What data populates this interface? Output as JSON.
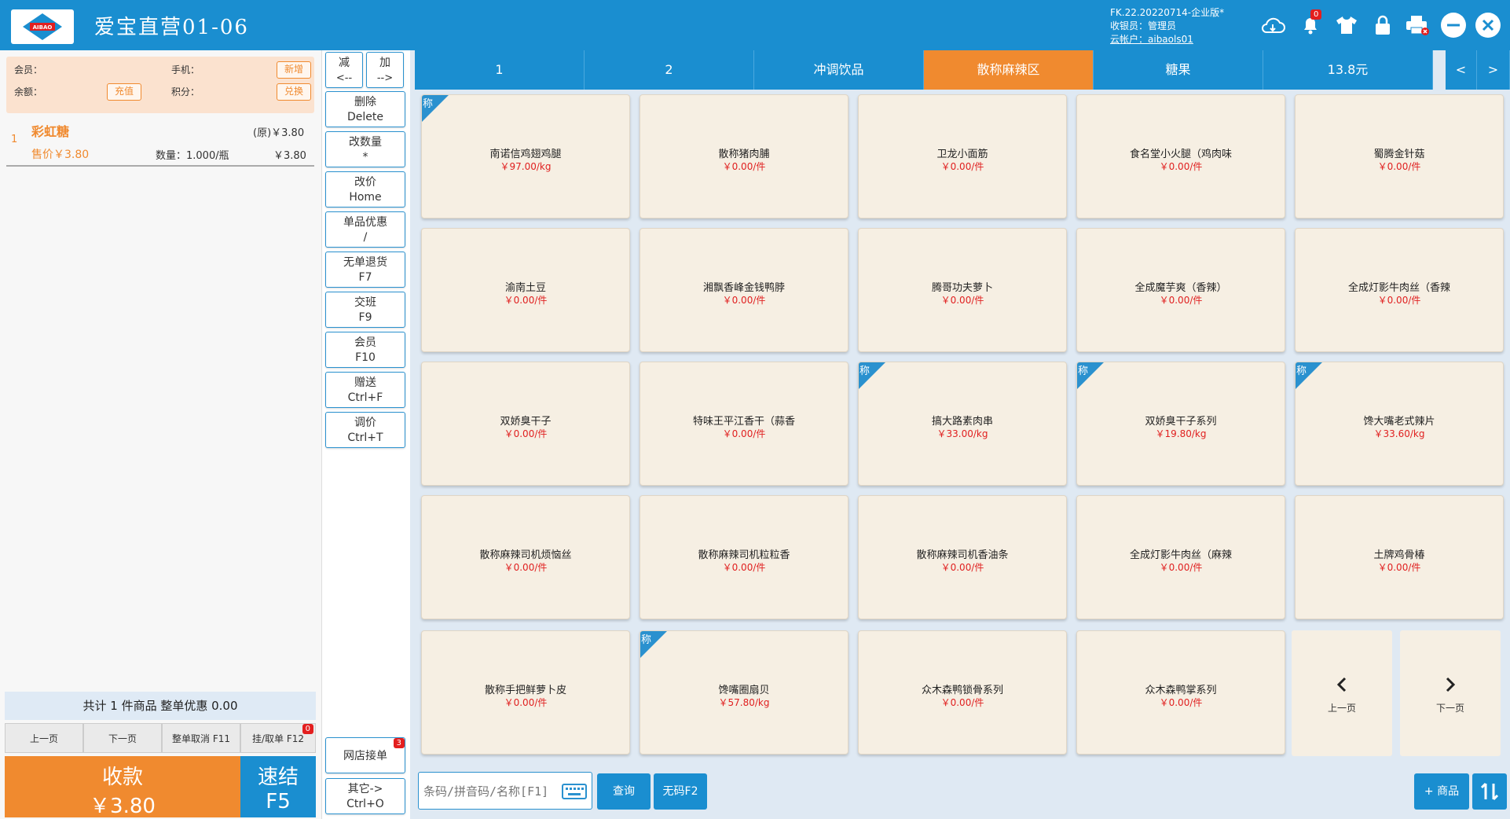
{
  "header": {
    "logo_text": "AIBAO",
    "logo_sub": "爱宝",
    "store_title": "爱宝直营01-06",
    "version": "FK.22.20220714-企业版*",
    "cashier": "收银员：管理员",
    "cloud_account": "云帐户：aibaols01",
    "notify_count": "0"
  },
  "member": {
    "member_label": "会员：",
    "phone_label": "手机：",
    "balance_label": "余额：",
    "points_label": "积分：",
    "new_btn": "新增",
    "recharge_btn": "充值",
    "redeem_btn": "兑换"
  },
  "cart": {
    "items": [
      {
        "index": "1",
        "name": "彩虹糖",
        "orig_price": "(原)￥3.80",
        "sale_price": "售价￥3.80",
        "qty": "数量：1.000/瓶",
        "subtotal": "￥3.80"
      }
    ],
    "summary": "共计 1 件商品 整单优惠 0.00",
    "prev_page": "上一页",
    "next_page": "下一页",
    "cancel_all": "整单取消 F11",
    "hold_order": "挂/取单 F12",
    "hold_count": "0",
    "pay_label": "收款",
    "pay_amount": "￥3.80",
    "quick_label": "速结",
    "quick_key": "F5"
  },
  "functions": {
    "minus": "减",
    "minus_key": "<--",
    "plus": "加",
    "plus_key": "-->",
    "buttons": [
      {
        "label": "删除",
        "key": "Delete"
      },
      {
        "label": "改数量",
        "key": "*"
      },
      {
        "label": "改价",
        "key": "Home"
      },
      {
        "label": "单品优惠",
        "key": "/"
      },
      {
        "label": "无单退货",
        "key": "F7"
      },
      {
        "label": "交班",
        "key": "F9"
      },
      {
        "label": "会员",
        "key": "F10"
      },
      {
        "label": "赠送",
        "key": "Ctrl+F"
      },
      {
        "label": "调价",
        "key": "Ctrl+T"
      }
    ],
    "online_order": "网店接单",
    "online_count": "3",
    "other": "其它->",
    "other_key": "Ctrl+O"
  },
  "tabs": [
    {
      "label": "1"
    },
    {
      "label": "2"
    },
    {
      "label": "冲调饮品"
    },
    {
      "label": "散称麻辣区"
    },
    {
      "label": "糖果"
    },
    {
      "label": "13.8元"
    }
  ],
  "tab_prev": "<",
  "tab_next": ">",
  "weigh_tag": "称",
  "products": [
    {
      "name": "南诺信鸡翅鸡腿",
      "price": "￥97.00/kg",
      "weighed": true
    },
    {
      "name": "散称猪肉脯",
      "price": "￥0.00/件",
      "weighed": false
    },
    {
      "name": "卫龙小面筋",
      "price": "￥0.00/件",
      "weighed": false
    },
    {
      "name": "食名堂小火腿（鸡肉味",
      "price": "￥0.00/件",
      "weighed": false
    },
    {
      "name": "蜀腾金针菇",
      "price": "￥0.00/件",
      "weighed": false
    },
    {
      "name": "渝南土豆",
      "price": "￥0.00/件",
      "weighed": false
    },
    {
      "name": "湘飘香峰金钱鸭脖",
      "price": "￥0.00/件",
      "weighed": false
    },
    {
      "name": "腾哥功夫萝卜",
      "price": "￥0.00/件",
      "weighed": false
    },
    {
      "name": "全成魔芋爽（香辣）",
      "price": "￥0.00/件",
      "weighed": false
    },
    {
      "name": "全成灯影牛肉丝（香辣",
      "price": "￥0.00/件",
      "weighed": false
    },
    {
      "name": "双娇臭干子",
      "price": "￥0.00/件",
      "weighed": false
    },
    {
      "name": "特味王平江香干（蒜香",
      "price": "￥0.00/件",
      "weighed": false
    },
    {
      "name": "搞大路素肉串",
      "price": "￥33.00/kg",
      "weighed": true
    },
    {
      "name": "双娇臭干子系列",
      "price": "￥19.80/kg",
      "weighed": true
    },
    {
      "name": "馋大嘴老式辣片",
      "price": "￥33.60/kg",
      "weighed": true
    },
    {
      "name": "散称麻辣司机烦恼丝",
      "price": "￥0.00/件",
      "weighed": false
    },
    {
      "name": "散称麻辣司机粒粒香",
      "price": "￥0.00/件",
      "weighed": false
    },
    {
      "name": "散称麻辣司机香油条",
      "price": "￥0.00/件",
      "weighed": false
    },
    {
      "name": "全成灯影牛肉丝（麻辣",
      "price": "￥0.00/件",
      "weighed": false
    },
    {
      "name": "土牌鸡骨椿",
      "price": "￥0.00/件",
      "weighed": false
    },
    {
      "name": "散称手把鲜萝卜皮",
      "price": "￥0.00/件",
      "weighed": false
    },
    {
      "name": "馋嘴圈扇贝",
      "price": "￥57.80/kg",
      "weighed": true
    },
    {
      "name": "众木森鸭锁骨系列",
      "price": "￥0.00/件",
      "weighed": false
    },
    {
      "name": "众木森鸭掌系列",
      "price": "￥0.00/件",
      "weighed": false
    }
  ],
  "grid_prev": "上一页",
  "grid_next": "下一页",
  "search": {
    "placeholder": "条码/拼音码/名称[F1]",
    "query_btn": "查询",
    "nocode_btn": "无码F2",
    "add_goods_btn": "+ 商品"
  },
  "colors": {
    "brand_blue": "#1a8ed0",
    "accent_orange": "#f08a2f",
    "price_red": "#e02020",
    "card_bg": "#f6efe3"
  }
}
